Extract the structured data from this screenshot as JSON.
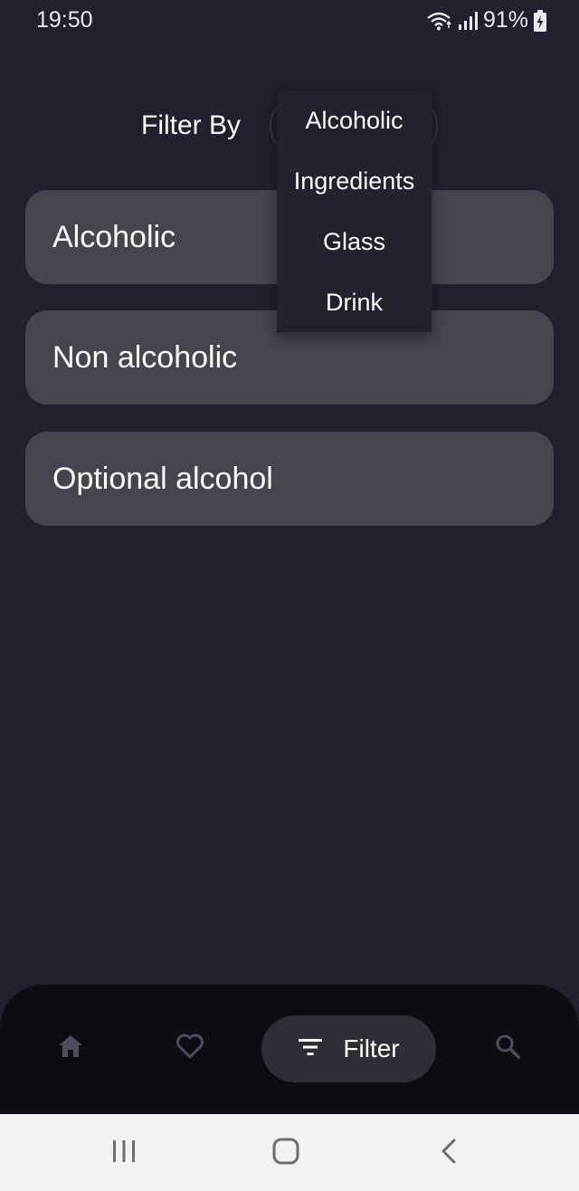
{
  "status_bar": {
    "time": "19:50",
    "battery_percent": "91%",
    "icons": [
      "wifi-icon",
      "signal-icon",
      "battery-charging-icon"
    ]
  },
  "header": {
    "filter_by_label": "Filter By"
  },
  "options": [
    {
      "label": "Alcoholic"
    },
    {
      "label": "Non alcoholic"
    },
    {
      "label": "Optional alcohol"
    }
  ],
  "dropdown": {
    "items": [
      {
        "label": "Alcoholic"
      },
      {
        "label": "Ingredients"
      },
      {
        "label": "Glass"
      },
      {
        "label": "Drink"
      }
    ]
  },
  "bottom_nav": {
    "items": [
      {
        "icon": "home-icon"
      },
      {
        "icon": "heart-icon"
      },
      {
        "icon": "filter-icon",
        "label": "Filter",
        "active": true
      },
      {
        "icon": "search-icon"
      }
    ]
  },
  "colors": {
    "background": "#21202e",
    "card": "#47434f",
    "nav_background": "#0c0c11",
    "active_pill": "#2f2e37",
    "inactive_icon": "#4f4b5c"
  }
}
